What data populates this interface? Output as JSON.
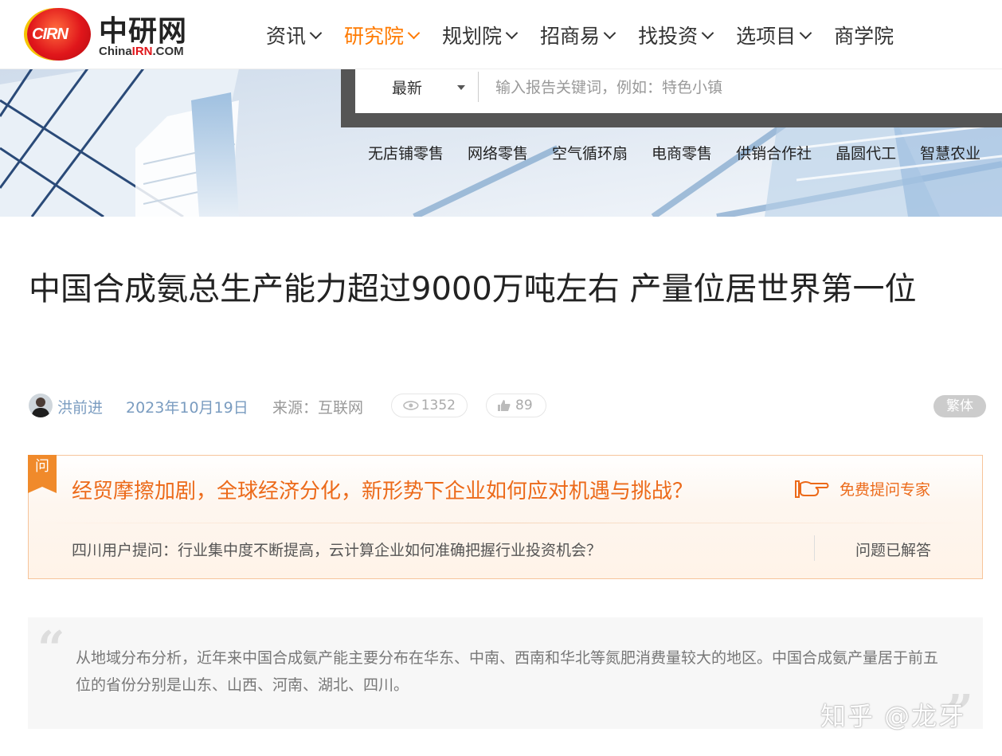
{
  "logo": {
    "badge": "CIRN",
    "cn": "中研网",
    "en_prefix": "China",
    "en_brand": "IRN",
    "en_suffix": ".COM"
  },
  "nav": [
    {
      "label": "资讯"
    },
    {
      "label": "研究院"
    },
    {
      "label": "规划院"
    },
    {
      "label": "招商易"
    },
    {
      "label": "找投资"
    },
    {
      "label": "选项目"
    },
    {
      "label": "商学院"
    }
  ],
  "search": {
    "selected": "最新",
    "placeholder": "输入报告关键词，例如：特色小镇"
  },
  "hot_tags": [
    "无店铺零售",
    "网络零售",
    "空气循环扇",
    "电商零售",
    "供销合作社",
    "晶圆代工",
    "智慧农业"
  ],
  "article": {
    "title": "中国合成氨总生产能力超过9000万吨左右 产量位居世界第一位",
    "author": "洪前进",
    "date": "2023年10月19日",
    "source": "来源：互联网",
    "views": "1352",
    "likes": "89",
    "traditional": "繁体"
  },
  "ask": {
    "tag": "问",
    "question": "经贸摩擦加剧，全球经济分化，新形势下企业如何应对机遇与挑战？",
    "expert_link": "免费提问专家",
    "sub_question": "四川用户提问：行业集中度不断提高，云计算企业如何准确把握行业投资机会？",
    "answered": "问题已解答"
  },
  "quote": {
    "text": "从地域分布分析，近年来中国合成氨产能主要分布在华东、中南、西南和华北等氮肥消费量较大的地区。中国合成氨产量居于前五位的省份分别是山东、山西、河南、湖北、四川。"
  },
  "watermark": "知乎 @龙牙",
  "colors": {
    "accent": "#ff7a00",
    "brand_red": "#e0161b",
    "link_blue": "#7a9cc0"
  }
}
